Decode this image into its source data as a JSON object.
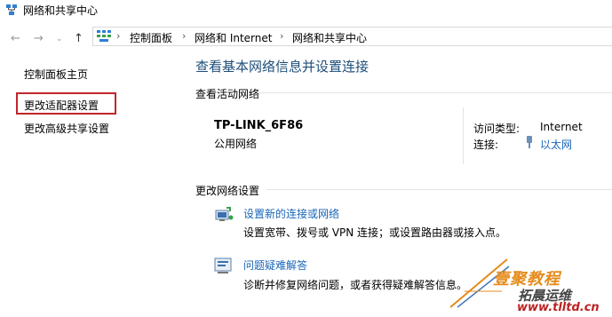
{
  "window": {
    "title": "网络和共享中心"
  },
  "address_bar": {
    "breadcrumbs": [
      "控制面板",
      "网络和 Internet",
      "网络和共享中心"
    ]
  },
  "left_pane": {
    "links": [
      "控制面板主页",
      "更改适配器设置",
      "更改高级共享设置"
    ]
  },
  "main": {
    "title": "查看基本网络信息并设置连接",
    "active_section_label": "查看活动网络",
    "network": {
      "name": "TP-LINK_6F86",
      "type": "公用网络",
      "access_label": "访问类型:",
      "access_value": "Internet",
      "connection_label": "连接:",
      "connection_value": "以太网"
    },
    "change_section_label": "更改网络设置",
    "tasks": [
      {
        "title": "设置新的连接或网络",
        "desc": "设置宽带、拨号或 VPN 连接；或设置路由器或接入点。"
      },
      {
        "title": "问题疑难解答",
        "desc": "诊断并修复网络问题，或者获得疑难解答信息。"
      }
    ]
  },
  "watermark": {
    "line1": "壹聚教程",
    "line2": "拓晨运维",
    "line3": "www.tlltd.cn"
  },
  "colors": {
    "link": "#1a66b8",
    "title": "#1e4e79",
    "highlight_border": "#c0262c"
  }
}
